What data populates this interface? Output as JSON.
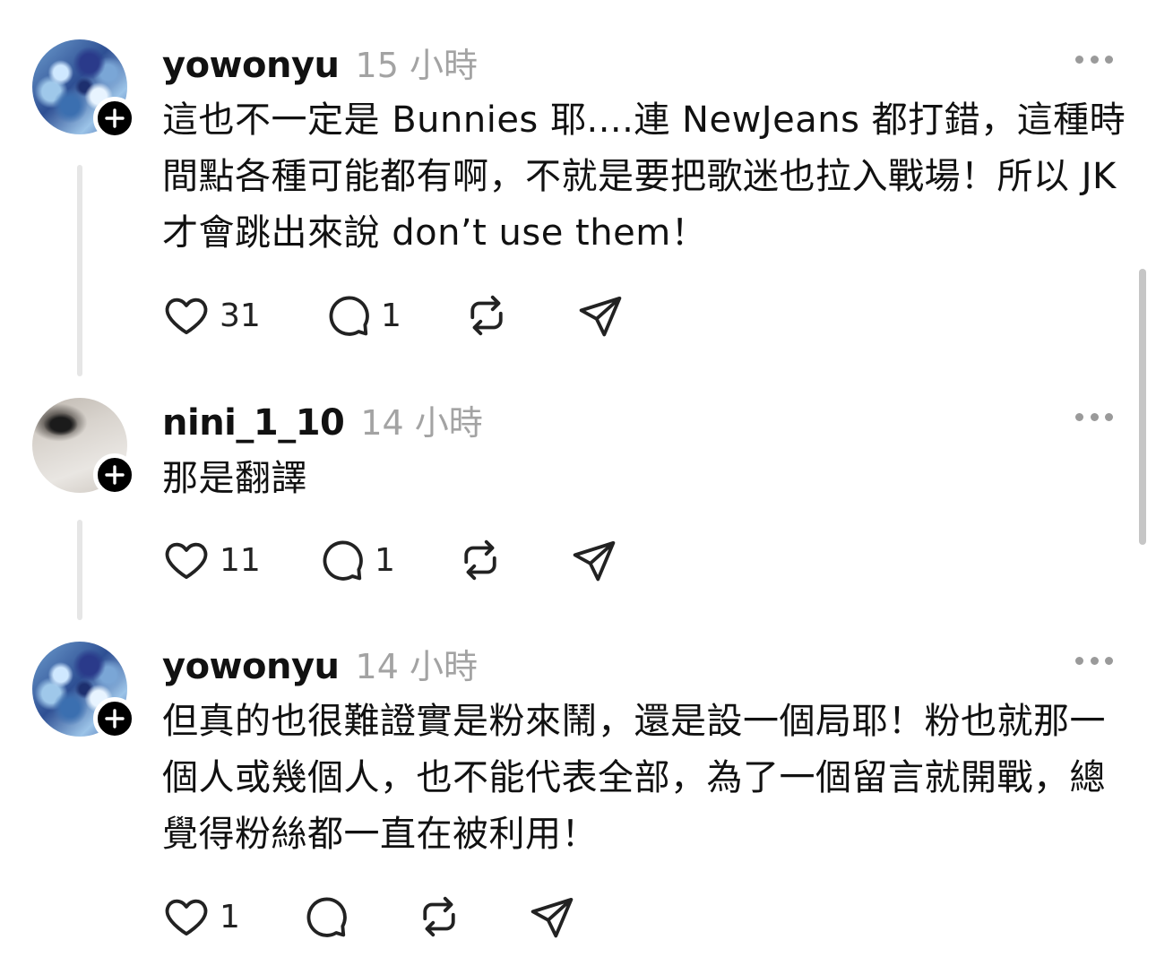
{
  "posts": [
    {
      "username": "yowonyu",
      "time": "15 小時",
      "text": "這也不一定是 Bunnies 耶....連 NewJeans 都打錯，這種時間點各種可能都有啊，不就是要把歌迷也拉入戰場！所以 JK 才會跳出來說 don’t use them！",
      "likes": "31",
      "replies": "1"
    },
    {
      "username": "nini_1_10",
      "time": "14 小時",
      "text": "那是翻譯",
      "likes": "11",
      "replies": "1"
    },
    {
      "username": "yowonyu",
      "time": "14 小時",
      "text": "但真的也很難證實是粉來鬧，還是設一個局耶！粉也就那一個人或幾個人，也不能代表全部，為了一個留言就開戰，總覺得粉絲都一直在被利用！",
      "likes": "1",
      "replies": ""
    }
  ],
  "icons": {
    "follow": "plus-icon",
    "like": "heart-icon",
    "reply": "comment-icon",
    "repost": "repost-icon",
    "share": "send-icon",
    "menu": "more-icon"
  },
  "colors": {
    "text": "#111111",
    "muted": "#a3a3a3",
    "thread_line": "#e6e6e6"
  }
}
